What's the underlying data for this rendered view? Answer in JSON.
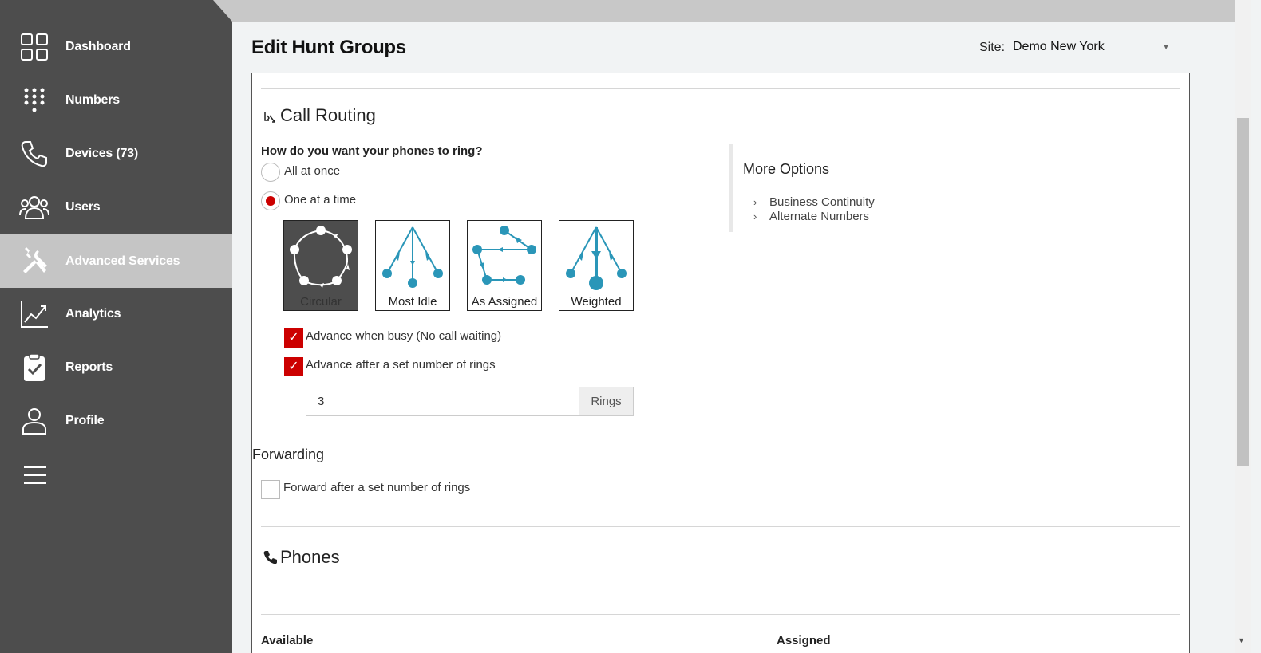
{
  "sidebar": {
    "items": [
      {
        "label": "Dashboard",
        "icon": "dashboard-grid-icon"
      },
      {
        "label": "Numbers",
        "icon": "dialpad-icon"
      },
      {
        "label": "Devices (73)",
        "icon": "phone-icon"
      },
      {
        "label": "Users",
        "icon": "users-icon"
      },
      {
        "label": "Advanced Services",
        "icon": "tools-icon",
        "active": true
      },
      {
        "label": "Analytics",
        "icon": "analytics-chart-icon"
      },
      {
        "label": "Reports",
        "icon": "clipboard-check-icon"
      },
      {
        "label": "Profile",
        "icon": "profile-icon"
      }
    ],
    "menu_icon": "hamburger-menu-icon"
  },
  "header": {
    "title": "Edit Hunt Groups",
    "site_label": "Site:",
    "site_value": "Demo New York"
  },
  "call_routing": {
    "title": "Call Routing",
    "question": "How do you want your phones to ring?",
    "options": [
      "All at once",
      "One at a time"
    ],
    "selected_option": "One at a time",
    "methods": [
      "Circular",
      "Most Idle",
      "As Assigned",
      "Weighted"
    ],
    "selected_method": "Circular",
    "advance_busy": "Advance when busy (No call waiting)",
    "advance_rings": "Advance after a set number of rings",
    "rings_value": "3",
    "rings_unit": "Rings"
  },
  "forwarding": {
    "title": "Forwarding",
    "forward_rings": "Forward after a set number of rings"
  },
  "more_options": {
    "title": "More Options",
    "links": [
      "Business Continuity",
      "Alternate Numbers"
    ]
  },
  "phones": {
    "title": "Phones",
    "available": "Available",
    "assigned": "Assigned"
  },
  "colors": {
    "sidebar_bg": "#4d4d4d",
    "active_bg": "#c5c5c5",
    "accent_red": "#cc0000",
    "diagram_blue": "#2a96b8"
  }
}
